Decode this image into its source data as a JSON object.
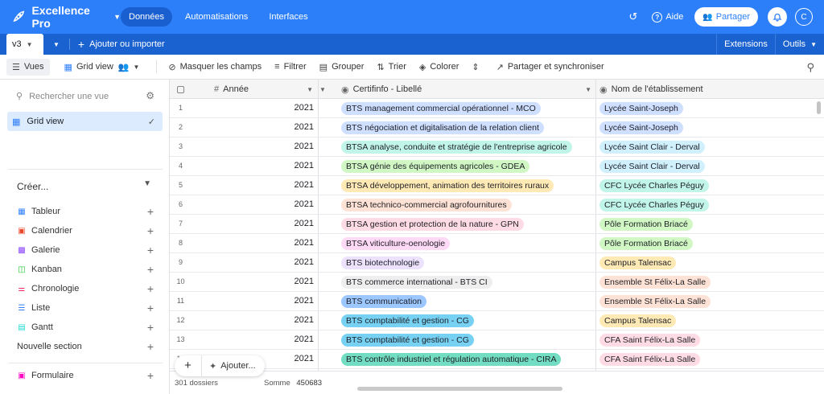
{
  "app": {
    "name": "Excellence Pro"
  },
  "topnav": [
    "Données",
    "Automatisations",
    "Interfaces"
  ],
  "topright": {
    "help": "Aide",
    "share": "Partager",
    "avatar": "C"
  },
  "tabs": {
    "active": "v3",
    "add_import": "Ajouter ou importer",
    "extensions": "Extensions",
    "tools": "Outils"
  },
  "toolbar": {
    "views": "Vues",
    "grid_view": "Grid view",
    "hide_fields": "Masquer les champs",
    "filter": "Filtrer",
    "group": "Grouper",
    "sort": "Trier",
    "color": "Colorer",
    "share_sync": "Partager et synchroniser"
  },
  "sidebar": {
    "search_placeholder": "Rechercher une vue",
    "current_view": "Grid view",
    "create_label": "Créer...",
    "create_items": [
      {
        "label": "Tableur",
        "icon": "grid-icon"
      },
      {
        "label": "Calendrier",
        "icon": "calendar-icon"
      },
      {
        "label": "Galerie",
        "icon": "gallery-icon"
      },
      {
        "label": "Kanban",
        "icon": "kanban-icon"
      },
      {
        "label": "Chronologie",
        "icon": "timeline-icon"
      },
      {
        "label": "Liste",
        "icon": "list-icon"
      },
      {
        "label": "Gantt",
        "icon": "gantt-icon"
      },
      {
        "label": "Nouvelle section",
        "icon": ""
      }
    ],
    "form_label": "Formulaire"
  },
  "grid": {
    "columns": [
      "Année",
      "Certifinfo - Libellé",
      "Nom de l'établissement"
    ],
    "rows": [
      {
        "n": "1",
        "year": "2021",
        "cert": "BTS management commercial opérationnel - MCO",
        "cert_color": "#cfdfff",
        "etab": "Lycée Saint-Joseph",
        "etab_color": "#cfdfff"
      },
      {
        "n": "2",
        "year": "2021",
        "cert": "BTS négociation et digitalisation de la relation client",
        "cert_color": "#cfdfff",
        "etab": "Lycée Saint-Joseph",
        "etab_color": "#cfdfff"
      },
      {
        "n": "3",
        "year": "2021",
        "cert": "BTSA analyse, conduite et stratégie de l'entreprise agricole",
        "cert_color": "#c2f5e9",
        "etab": "Lycée Saint Clair - Derval",
        "etab_color": "#d0f0fd"
      },
      {
        "n": "4",
        "year": "2021",
        "cert": "BTSA génie des équipements agricoles - GDEA",
        "cert_color": "#d1f7c4",
        "etab": "Lycée Saint Clair - Derval",
        "etab_color": "#d0f0fd"
      },
      {
        "n": "5",
        "year": "2021",
        "cert": "BTSA développement, animation des territoires ruraux",
        "cert_color": "#ffeab6",
        "etab": "CFC Lycée Charles Péguy",
        "etab_color": "#c2f5e9"
      },
      {
        "n": "6",
        "year": "2021",
        "cert": "BTSA technico-commercial agrofournitures",
        "cert_color": "#fee2d5",
        "etab": "CFC Lycée Charles Péguy",
        "etab_color": "#c2f5e9"
      },
      {
        "n": "7",
        "year": "2021",
        "cert": "BTSA gestion et protection de la nature - GPN",
        "cert_color": "#ffdce5",
        "etab": "Pôle Formation Briacé",
        "etab_color": "#d1f7c4"
      },
      {
        "n": "8",
        "year": "2021",
        "cert": "BTSA viticulture-oenologie",
        "cert_color": "#ffdaf6",
        "etab": "Pôle Formation Briacé",
        "etab_color": "#d1f7c4"
      },
      {
        "n": "9",
        "year": "2021",
        "cert": "BTS biotechnologie",
        "cert_color": "#ede2fe",
        "etab": "Campus Talensac",
        "etab_color": "#ffeab6"
      },
      {
        "n": "10",
        "year": "2021",
        "cert": "BTS commerce international - BTS CI",
        "cert_color": "#eeeeee",
        "etab": "Ensemble St Félix-La Salle",
        "etab_color": "#fee2d5"
      },
      {
        "n": "11",
        "year": "2021",
        "cert": "BTS communication",
        "cert_color": "#9cc7ff",
        "etab": "Ensemble St Félix-La Salle",
        "etab_color": "#fee2d5"
      },
      {
        "n": "12",
        "year": "2021",
        "cert": "BTS comptabilité et gestion - CG",
        "cert_color": "#77d1f3",
        "etab": "Campus Talensac",
        "etab_color": "#ffeab6"
      },
      {
        "n": "13",
        "year": "2021",
        "cert": "BTS comptabilité et gestion - CG",
        "cert_color": "#77d1f3",
        "etab": "CFA Saint Félix-La Salle",
        "etab_color": "#ffdce5"
      },
      {
        "n": "14",
        "year": "2021",
        "cert": "BTS contrôle industriel et régulation automatique - CIRA",
        "cert_color": "#72ddc3",
        "etab": "CFA Saint Félix-La Salle",
        "etab_color": "#ffdce5"
      }
    ],
    "footer": {
      "count": "301 dossiers",
      "sum_label": "Somme",
      "sum_value": "450683"
    },
    "add_label": "Ajouter..."
  },
  "colors": {
    "brand": "#2d7ff9",
    "brand_dark": "#1b62d1"
  }
}
